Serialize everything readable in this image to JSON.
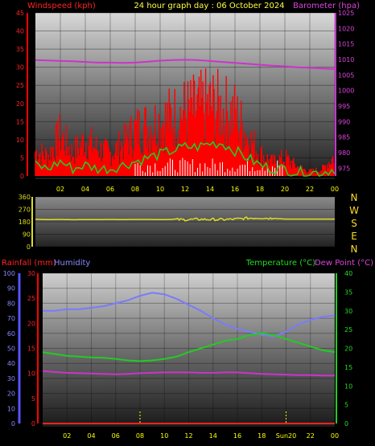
{
  "header": {
    "left_title": "Windspeed (kph)",
    "center_title": "24 hour graph day : 06 October 2024",
    "right_title": "Barometer (hpa)"
  },
  "lower_header": {
    "rainfall": "Rainfall (mm)",
    "humidity": "Humidity",
    "temperature": "Temperature (°C)",
    "dew_point": "Dew Point (°C)"
  },
  "colors": {
    "background": "#000000",
    "wind": "#ff0000",
    "gust": "#22cc22",
    "barometer": "#cc33cc",
    "direction": "#dddd22",
    "humidity": "#7a7aff",
    "temperature": "#22cc22",
    "dewpoint": "#cc33cc",
    "rain": "#ff2222",
    "hour_label": "#ffff00"
  },
  "chart_data": [
    {
      "type": "line",
      "panel": "wind_barometer",
      "title": "24 hour graph day : 06 October 2024",
      "x_ticks": [
        "02",
        "04",
        "06",
        "08",
        "10",
        "12",
        "14",
        "16",
        "18",
        "20",
        "22",
        "00"
      ],
      "ylabel_left": "Windspeed (kph)",
      "ylim_left": [
        0,
        45
      ],
      "yticks_left": [
        "0",
        "5",
        "10",
        "15",
        "20",
        "25",
        "30",
        "35",
        "40",
        "45"
      ],
      "ylabel_right": "Barometer (hpa)",
      "ylim_right": [
        972.5,
        1025
      ],
      "yticks_right": [
        "975",
        "980",
        "985",
        "990",
        "995",
        "1000",
        "1005",
        "1010",
        "1015",
        "1020",
        "1025"
      ],
      "x_hours": [
        0,
        1,
        2,
        3,
        4,
        5,
        6,
        7,
        8,
        9,
        10,
        11,
        12,
        13,
        14,
        15,
        16,
        17,
        18,
        19,
        20,
        21,
        22,
        23,
        24
      ],
      "series": [
        {
          "key": "wind_peak",
          "values": [
            11,
            9,
            18,
            10,
            16,
            12,
            10,
            14,
            20,
            22,
            24,
            26,
            28,
            29,
            31,
            29,
            27,
            18,
            10,
            6,
            8,
            4,
            2,
            3,
            9
          ]
        },
        {
          "key": "gust",
          "values": [
            3,
            2,
            4,
            2,
            3,
            2,
            2,
            3,
            4,
            5,
            6,
            7,
            8,
            8,
            9,
            9,
            7,
            5,
            3,
            2,
            2,
            1,
            1,
            1,
            2
          ]
        },
        {
          "key": "barometer",
          "values": [
            1009.8,
            1009.7,
            1009.5,
            1009.4,
            1009.2,
            1009.0,
            1009.0,
            1008.9,
            1009.0,
            1009.3,
            1009.6,
            1009.8,
            1009.9,
            1009.8,
            1009.5,
            1009.2,
            1008.9,
            1008.6,
            1008.3,
            1008.0,
            1007.8,
            1007.5,
            1007.3,
            1007.1,
            1006.9
          ]
        }
      ]
    },
    {
      "type": "line",
      "panel": "wind_direction",
      "ylim": [
        0,
        360
      ],
      "yticks": [
        "0",
        "90",
        "180",
        "270",
        "360"
      ],
      "compass": [
        "N",
        "W",
        "S",
        "E",
        "N"
      ],
      "series": [
        {
          "key": "direction",
          "values": [
            198,
            196,
            197,
            195,
            196,
            196,
            197,
            196,
            197,
            197,
            196,
            197,
            195,
            198,
            197,
            196,
            199,
            206,
            208,
            205,
            200,
            200,
            200,
            200,
            200
          ]
        }
      ]
    },
    {
      "type": "line",
      "panel": "rain_humidity_temp",
      "x_ticks": [
        "02",
        "04",
        "06",
        "08",
        "10",
        "12",
        "14",
        "16",
        "18",
        "Sun20",
        "22",
        "00"
      ],
      "ylabel_rain": "Rainfall (mm)",
      "ylim_rain": [
        0,
        30
      ],
      "yticks_rain": [
        "0",
        "5",
        "10",
        "15",
        "20",
        "25",
        "30"
      ],
      "ylabel_humidity": "Humidity",
      "ylim_humidity": [
        0,
        100
      ],
      "yticks_humidity": [
        "0",
        "10",
        "20",
        "30",
        "40",
        "50",
        "60",
        "70",
        "80",
        "90",
        "100"
      ],
      "ylabel_temp": "Temperature (°C)",
      "ylim_temp": [
        0,
        40
      ],
      "yticks_temp": [
        "0",
        "5",
        "10",
        "15",
        "20",
        "25",
        "30",
        "35",
        "40"
      ],
      "markers": [
        {
          "label": "08",
          "hour": 8
        },
        {
          "label": "Sun20",
          "hour": 20
        }
      ],
      "series": [
        {
          "key": "humidity",
          "values": [
            75,
            75,
            76,
            76,
            77,
            78,
            80,
            82,
            85,
            87,
            86,
            83,
            79,
            75,
            70,
            66,
            63,
            61,
            59,
            58,
            61,
            66,
            69,
            71,
            72
          ]
        },
        {
          "key": "temperature",
          "values": [
            19,
            18.5,
            18,
            17.8,
            17.6,
            17.5,
            17.2,
            16.8,
            16.6,
            16.8,
            17.2,
            17.8,
            19.0,
            20.0,
            21.0,
            22.0,
            22.5,
            23.5,
            24.0,
            23.5,
            22.5,
            21.5,
            20.5,
            19.5,
            19.0
          ]
        },
        {
          "key": "dewpoint",
          "values": [
            14,
            13.7,
            13.5,
            13.4,
            13.3,
            13.2,
            13.1,
            13.2,
            13.4,
            13.5,
            13.6,
            13.6,
            13.6,
            13.5,
            13.5,
            13.6,
            13.6,
            13.4,
            13.2,
            13.1,
            13.0,
            12.9,
            12.9,
            12.8,
            12.8
          ]
        },
        {
          "key": "rain",
          "values": [
            0,
            0,
            0,
            0,
            0,
            0,
            0,
            0,
            0,
            0,
            0,
            0,
            0,
            0,
            0,
            0,
            0,
            0,
            0,
            0,
            0,
            0,
            0,
            0,
            0
          ]
        }
      ]
    }
  ]
}
